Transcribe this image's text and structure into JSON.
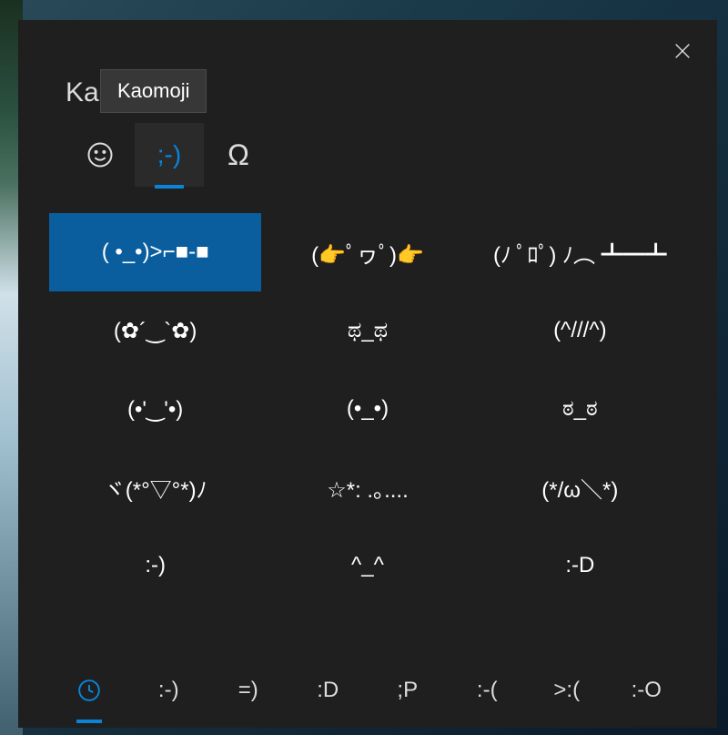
{
  "panel": {
    "title": "Ka",
    "tooltip": "Kaomoji"
  },
  "tabs": [
    {
      "name": "emoji",
      "glyph_type": "smiley",
      "active": false
    },
    {
      "name": "kaomoji",
      "glyph": ";-)",
      "active": true
    },
    {
      "name": "symbols",
      "glyph": "Ω",
      "active": false
    }
  ],
  "kaomoji_items": [
    {
      "text": "( •_•)>⌐■-■",
      "selected": true
    },
    {
      "text": "(👉ﾟヮﾟ)👉",
      "selected": false
    },
    {
      "text": "(ﾉ ﾟﾛﾟ) ﾉ︵ ┻━┻",
      "selected": false
    },
    {
      "text": "(✿´‿`✿)",
      "selected": false
    },
    {
      "text": "ಥ_ಥ",
      "selected": false
    },
    {
      "text": "(^///^)",
      "selected": false
    },
    {
      "text": "(•'‿'•)",
      "selected": false
    },
    {
      "text": "(•_•)",
      "selected": false
    },
    {
      "text": "ಠ_ಠ",
      "selected": false
    },
    {
      "text": "ヾ(*°▽°*)ﾉ",
      "selected": false
    },
    {
      "text": "☆*: .｡....",
      "selected": false
    },
    {
      "text": "(*/ω＼*)",
      "selected": false
    },
    {
      "text": ":-)",
      "selected": false
    },
    {
      "text": "^_^",
      "selected": false
    },
    {
      "text": ":-D",
      "selected": false
    }
  ],
  "bottom_categories": [
    {
      "name": "recent",
      "type": "clock",
      "active": true
    },
    {
      "name": "happy",
      "text": ":-)",
      "active": false
    },
    {
      "name": "equals",
      "text": "=)",
      "active": false
    },
    {
      "name": "bigd",
      "text": ":D",
      "active": false
    },
    {
      "name": "wink",
      "text": ";P",
      "active": false
    },
    {
      "name": "sad",
      "text": ":-(",
      "active": false
    },
    {
      "name": "angry",
      "text": ">:(",
      "active": false
    },
    {
      "name": "surprised",
      "text": ":-O",
      "active": false
    }
  ]
}
